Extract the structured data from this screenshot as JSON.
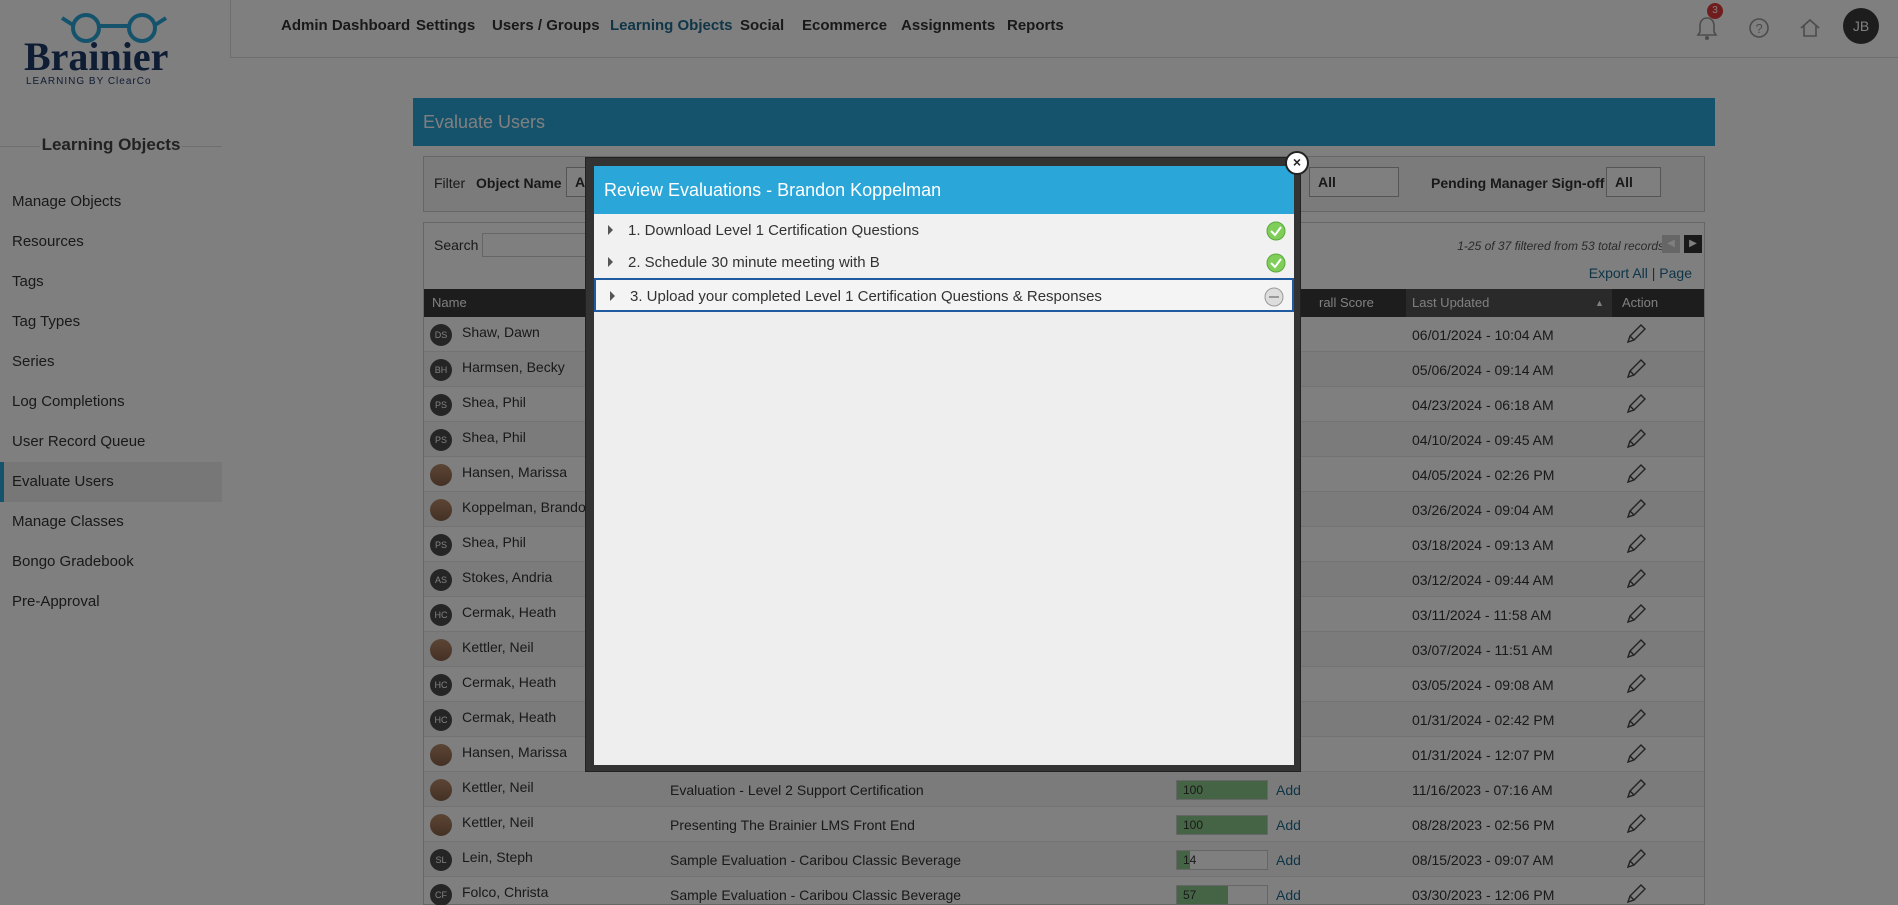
{
  "brand": {
    "name": "Brainier",
    "tagline": "LEARNING BY ClearCo"
  },
  "sidebar": {
    "title": "Learning Objects",
    "items": [
      {
        "label": "Manage Objects"
      },
      {
        "label": "Resources"
      },
      {
        "label": "Tags"
      },
      {
        "label": "Tag Types"
      },
      {
        "label": "Series"
      },
      {
        "label": "Log Completions"
      },
      {
        "label": "User Record Queue"
      },
      {
        "label": "Evaluate Users",
        "active": true
      },
      {
        "label": "Manage Classes"
      },
      {
        "label": "Bongo Gradebook"
      },
      {
        "label": "Pre-Approval"
      }
    ]
  },
  "topnav": {
    "items": [
      "Admin Dashboard",
      "Settings",
      "Users / Groups",
      "Learning Objects",
      "Social",
      "Ecommerce",
      "Assignments",
      "Reports"
    ],
    "active": "Learning Objects",
    "notification_count": "3",
    "user_initials": "JB"
  },
  "panel": {
    "title": "Evaluate Users",
    "filter": {
      "label": "Filter",
      "object_name_label": "Object Name",
      "object_name_value": "A",
      "status_value": "All",
      "pending_label": "Pending Manager Sign-off",
      "pending_value": "All"
    },
    "search_label": "Search",
    "records_text": "1-25 of 37 filtered from 53 total records",
    "export_all": "Export All",
    "export_sep": " | ",
    "export_page": "Page",
    "columns": {
      "name": "Name",
      "overall_score": "rall Score",
      "last_updated": "Last Updated",
      "action": "Action",
      "sort_glyph": "▲"
    }
  },
  "rows": [
    {
      "initials": "DS",
      "name": "Shaw, Dawn",
      "object": "",
      "score": "",
      "date": "06/01/2024 - 10:04 AM",
      "photo": false
    },
    {
      "initials": "BH",
      "name": "Harmsen, Becky",
      "object": "",
      "score": "",
      "date": "05/06/2024 - 09:14 AM",
      "photo": false
    },
    {
      "initials": "PS",
      "name": "Shea, Phil",
      "object": "",
      "score": "",
      "date": "04/23/2024 - 06:18 AM",
      "photo": false
    },
    {
      "initials": "PS",
      "name": "Shea, Phil",
      "object": "",
      "score": "",
      "date": "04/10/2024 - 09:45 AM",
      "photo": false
    },
    {
      "initials": "",
      "name": "Hansen, Marissa",
      "object": "",
      "score": "",
      "date": "04/05/2024 - 02:26 PM",
      "photo": true
    },
    {
      "initials": "",
      "name": "Koppelman, Brandon",
      "object": "",
      "score": "",
      "date": "03/26/2024 - 09:04 AM",
      "photo": true
    },
    {
      "initials": "PS",
      "name": "Shea, Phil",
      "object": "",
      "score": "",
      "date": "03/18/2024 - 09:13 AM",
      "photo": false
    },
    {
      "initials": "AS",
      "name": "Stokes, Andria",
      "object": "",
      "score": "",
      "date": "03/12/2024 - 09:44 AM",
      "photo": false
    },
    {
      "initials": "HC",
      "name": "Cermak, Heath",
      "object": "",
      "score": "",
      "date": "03/11/2024 - 11:58 AM",
      "photo": false
    },
    {
      "initials": "",
      "name": "Kettler, Neil",
      "object": "",
      "score": "",
      "date": "03/07/2024 - 11:51 AM",
      "photo": true
    },
    {
      "initials": "HC",
      "name": "Cermak, Heath",
      "object": "",
      "score": "",
      "date": "03/05/2024 - 09:08 AM",
      "photo": false
    },
    {
      "initials": "HC",
      "name": "Cermak, Heath",
      "object": "",
      "score": "",
      "date": "01/31/2024 - 02:42 PM",
      "photo": false
    },
    {
      "initials": "",
      "name": "Hansen, Marissa",
      "object": "",
      "score": "",
      "date": "01/31/2024 - 12:07 PM",
      "photo": true
    },
    {
      "initials": "",
      "name": "Kettler, Neil",
      "object": "Evaluation - Level 2 Support Certification",
      "score": "100",
      "date": "11/16/2023 - 07:16 AM",
      "photo": true
    },
    {
      "initials": "",
      "name": "Kettler, Neil",
      "object": "Presenting The Brainier LMS Front End",
      "score": "100",
      "date": "08/28/2023 - 02:56 PM",
      "photo": true
    },
    {
      "initials": "SL",
      "name": "Lein, Steph",
      "object": "Sample Evaluation - Caribou Classic Beverage",
      "score": "14",
      "date": "08/15/2023 - 09:07 AM",
      "photo": false
    },
    {
      "initials": "CF",
      "name": "Folco, Christa",
      "object": "Sample Evaluation - Caribou Classic Beverage",
      "score": "57",
      "date": "03/30/2023 - 12:06 PM",
      "photo": false
    }
  ],
  "add_label": "Add",
  "modal": {
    "title": "Review Evaluations - Brandon Koppelman",
    "items": [
      {
        "label": "1. Download Level 1 Certification Questions",
        "status": "complete"
      },
      {
        "label": "2. Schedule 30 minute meeting with B",
        "status": "complete"
      },
      {
        "label": "3. Upload your completed Level 1 Certification Questions & Responses",
        "status": "pending"
      }
    ],
    "close_glyph": "×"
  }
}
